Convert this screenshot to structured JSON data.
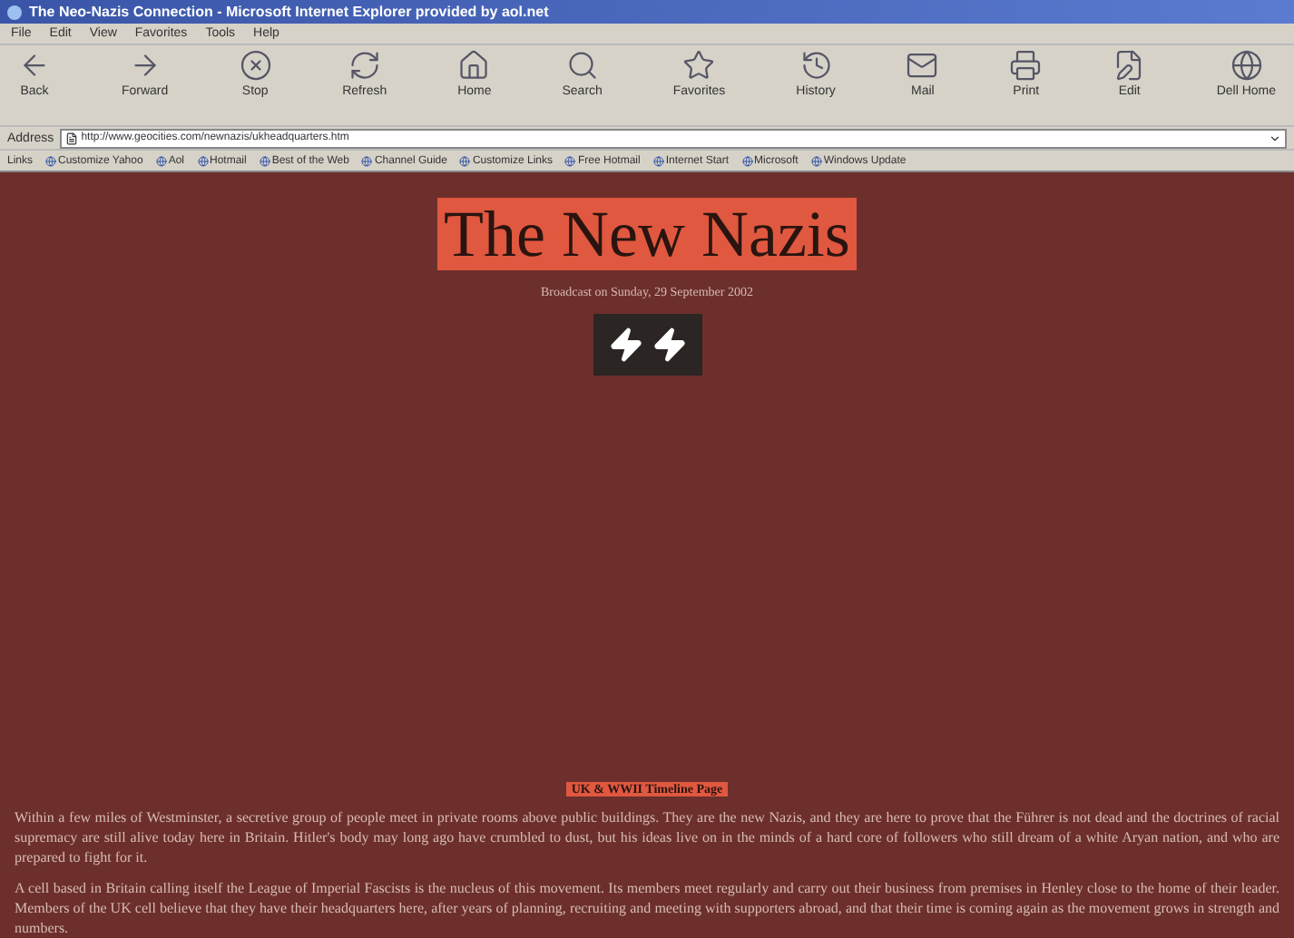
{
  "window": {
    "title": "The Neo-Nazis Connection - Microsoft Internet Explorer provided by aol.net"
  },
  "menu": [
    "File",
    "Edit",
    "View",
    "Favorites",
    "Tools",
    "Help"
  ],
  "toolbar": [
    {
      "label": "Back"
    },
    {
      "label": "Forward"
    },
    {
      "label": "Stop"
    },
    {
      "label": "Refresh"
    },
    {
      "label": "Home"
    },
    {
      "label": "Search"
    },
    {
      "label": "Favorites"
    },
    {
      "label": "History"
    },
    {
      "label": "Mail"
    },
    {
      "label": "Print"
    },
    {
      "label": "Edit"
    },
    {
      "label": "Dell Home"
    }
  ],
  "address": {
    "label": "Address",
    "url": "http://www.geocities.com/newnazis/ukheadquarters.htm"
  },
  "links": {
    "label": "Links",
    "items": [
      "Customize Yahoo",
      "Aol",
      "Hotmail",
      "Best of the Web",
      "Channel Guide",
      "Customize Links",
      "Free Hotmail",
      "Internet Start",
      "Microsoft",
      "Windows Update"
    ]
  },
  "page": {
    "heading": "The New Nazis",
    "subtitle": "Broadcast on Sunday, 29 September 2002",
    "label": "UK & WWII Timeline Page",
    "paragraphs": [
      "Within a few miles of Westminster, a secretive group of people meet in private rooms above public buildings. They are the new Nazis, and they are here to prove that the Führer is not dead and the doctrines of racial supremacy are still alive today here in Britain. Hitler's body may long ago have crumbled to dust, but his ideas live on in the minds of a hard core of followers who still dream of a white Aryan nation, and who are prepared to fight for it.",
      "A cell based in Britain calling itself the League of Imperial Fascists is the nucleus of this movement. Its members meet regularly and carry out their business from premises in Henley close to the home of their leader. Members of the UK cell believe that they have their headquarters here, after years of planning, recruiting and meeting with supporters abroad, and that their time is coming again as the movement grows in strength and numbers."
    ]
  }
}
